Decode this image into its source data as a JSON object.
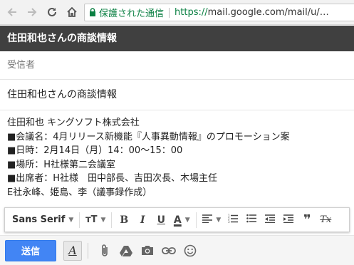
{
  "browser": {
    "secure_label": "保護された通信",
    "url_prefix": "https://",
    "url_rest": "mail.google.com/mail/u/…",
    "icons": [
      "back-icon",
      "forward-icon",
      "reload-icon",
      "home-icon",
      "lock-icon"
    ]
  },
  "compose": {
    "title": "住田和也さんの商談情報",
    "to_placeholder": "受信者",
    "subject": "住田和也さんの商談情報",
    "body_lines": [
      "住田和也 キングソフト株式会社",
      "■会議名：4月リリース新機能『人事異動情報』のプロモーション案",
      "■日時：2月14日（月）14：00〜15：00",
      "■場所：H社様第二会議室",
      "■出席者：H社様　田中部長、吉田次長、木場主任",
      "E社永峰、姫島、李（議事録作成）"
    ]
  },
  "format_toolbar": {
    "font_name": "Sans Serif",
    "size_label": "тT",
    "bold": "B",
    "italic": "I",
    "underline": "U",
    "text_color": "A",
    "quote": "❞",
    "clear": "Tx"
  },
  "actions": {
    "send_label": "送信",
    "format_toggle_label": "A"
  },
  "colors": {
    "send": "#4285f4",
    "secure": "#0b8043",
    "header": "#404040"
  }
}
